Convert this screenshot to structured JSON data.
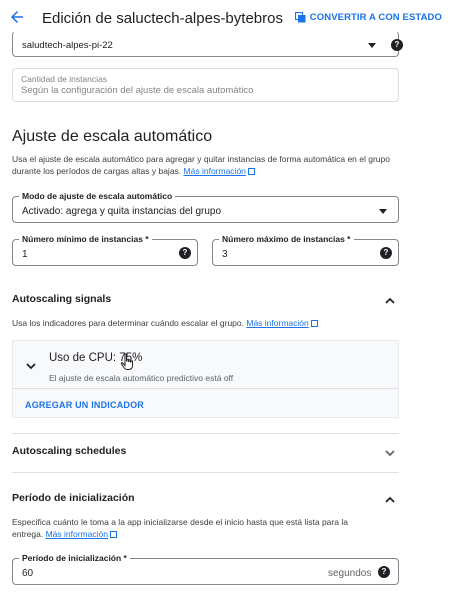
{
  "header": {
    "title": "Edición de saluctech-alpes-bytebros",
    "convert_label": "CONVERTIR A CON ESTADO"
  },
  "template_field": {
    "value": "saludtech-alpes-pi-22"
  },
  "instances": {
    "label": "Cantidad de instancias",
    "value": "Según la configuración del ajuste de escala automático"
  },
  "autoscaling": {
    "heading": "Ajuste de escala automático",
    "description": "Usa el ajuste de escala automático para agregar y quitar instancias de forma automática en el grupo durante los períodos de cargas altas y bajas.",
    "more_info": "Más información",
    "mode_label": "Modo de ajuste de escala automático",
    "mode_value": "Activado: agrega y quita instancias del grupo",
    "min_label": "Número mínimo de instancias *",
    "min_value": "1",
    "max_label": "Número máximo de instancias *",
    "max_value": "3"
  },
  "signals": {
    "title": "Autoscaling signals",
    "description": "Usa los indicadores para determinar cuándo escalar el grupo.",
    "more_info": "Más información",
    "cpu_title": "Uso de CPU: 75%",
    "cpu_sub": "El ajuste de escala automático predictivo está off",
    "add_indicator": "AGREGAR UN INDICADOR"
  },
  "schedules": {
    "title": "Autoscaling schedules"
  },
  "init": {
    "title": "Período de inicialización",
    "description_line1": "Especifica cuánto le toma a la app inicializarse desde el inicio hasta que está lista para la",
    "description_line2": "entrega.",
    "more_info": "Más información",
    "field_label": "Período de inicialización *",
    "field_value": "60",
    "unit": "segundos"
  },
  "colors": {
    "accent": "#1a73e8",
    "text": "#202124"
  }
}
